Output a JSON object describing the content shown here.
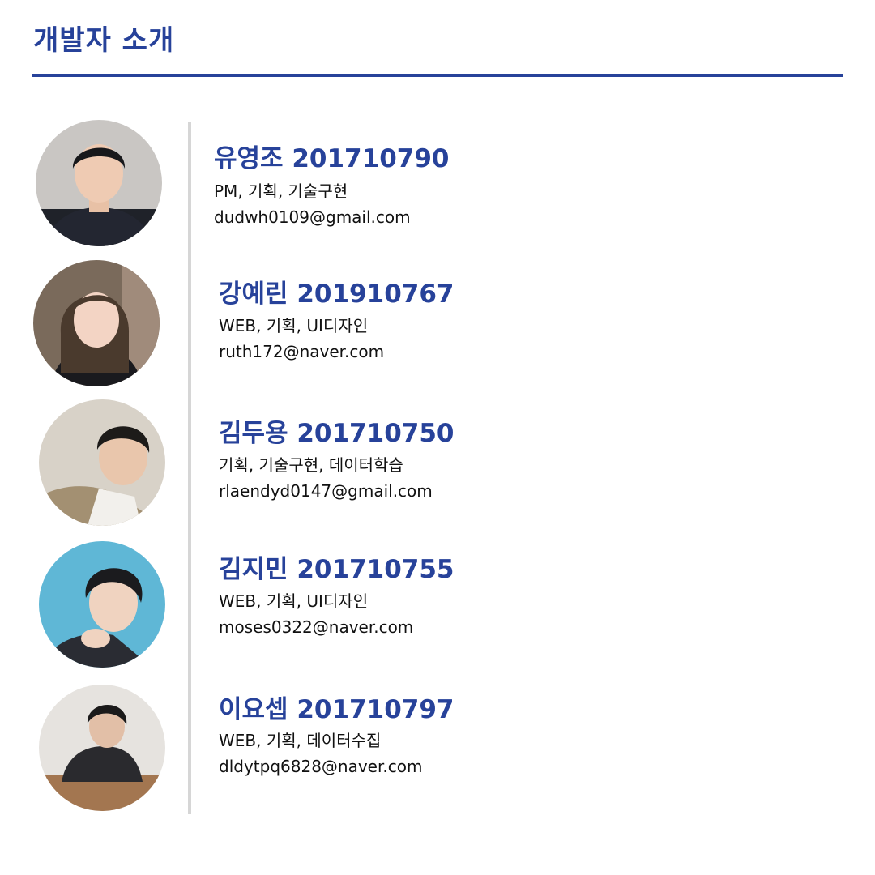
{
  "page": {
    "title": "개발자 소개",
    "accent_color": "#27429a"
  },
  "members": [
    {
      "name_line": "유영조 201710790",
      "roles": "PM, 기획, 기술구현",
      "email": "dudwh0109@gmail.com",
      "photo": "profile-photo"
    },
    {
      "name_line": "강예린 201910767",
      "roles": "WEB, 기획, UI디자인",
      "email": "ruth172@naver.com",
      "photo": "profile-photo"
    },
    {
      "name_line": "김두용 201710750",
      "roles": "기획, 기술구현, 데이터학습",
      "email": "rlaendyd0147@gmail.com",
      "photo": "profile-photo"
    },
    {
      "name_line": "김지민 201710755",
      "roles": "WEB, 기획, UI디자인",
      "email": "moses0322@naver.com",
      "photo": "profile-photo"
    },
    {
      "name_line": "이요셉 201710797",
      "roles": "WEB, 기획, 데이터수집",
      "email": "dldytpq6828@naver.com",
      "photo": "profile-photo"
    }
  ]
}
